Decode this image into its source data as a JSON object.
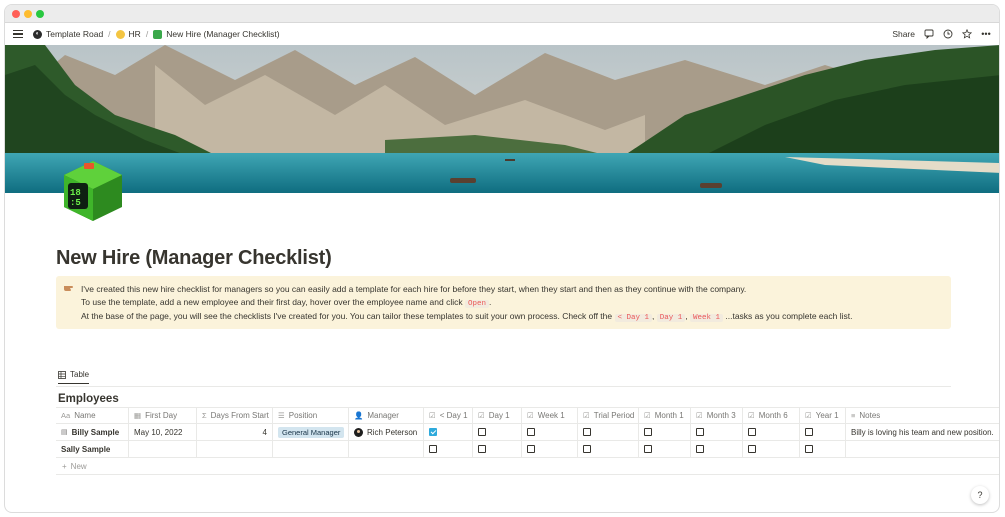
{
  "breadcrumb": [
    {
      "label": "Template Road",
      "icon": "road-logo-icon"
    },
    {
      "label": "HR",
      "icon": "face-emoji-icon"
    },
    {
      "label": "New Hire (Manager Checklist)",
      "icon": "cube-emoji-icon"
    }
  ],
  "topbar": {
    "share_label": "Share"
  },
  "page": {
    "title": "New Hire (Manager Checklist)"
  },
  "callout": {
    "line1": "I've created this new hire checklist for managers so you can easily add a template for each hire for before they start, when they start and then as they continue with the company.",
    "line2_pre": "To use the template, add a new employee and their first day, hover over the employee name and click ",
    "line2_code": "Open",
    "line2_post": ".",
    "line3_pre": "At the base of the page, you will see the checklists I've created for you. You can tailor these templates to suit your own process. Check off the ",
    "code_a": "< Day 1",
    "code_b": "Day 1",
    "code_c": "Week 1",
    "line3_post": " ...tasks as you complete each list."
  },
  "view_tab": {
    "label": "Table"
  },
  "database": {
    "title": "Employees",
    "columns": [
      "Name",
      "First Day",
      "Days From Start",
      "Position",
      "Manager",
      "< Day 1",
      "Day 1",
      "Week 1",
      "Trial Period",
      "Month 1",
      "Month 3",
      "Month 6",
      "Year 1",
      "Notes"
    ],
    "rows": [
      {
        "name": "Billy Sample",
        "first_day": "May 10, 2022",
        "days": "4",
        "position": "General Manager",
        "manager": "Rich Peterson",
        "checks": [
          true,
          false,
          false,
          false,
          false,
          false,
          false,
          false
        ],
        "notes": "Billy is loving his team and new position."
      },
      {
        "name": "Sally Sample",
        "first_day": "",
        "days": "",
        "position": "",
        "manager": "",
        "checks": [
          false,
          false,
          false,
          false,
          false,
          false,
          false,
          false
        ],
        "notes": ""
      }
    ],
    "new_label": "New"
  },
  "help_label": "?"
}
